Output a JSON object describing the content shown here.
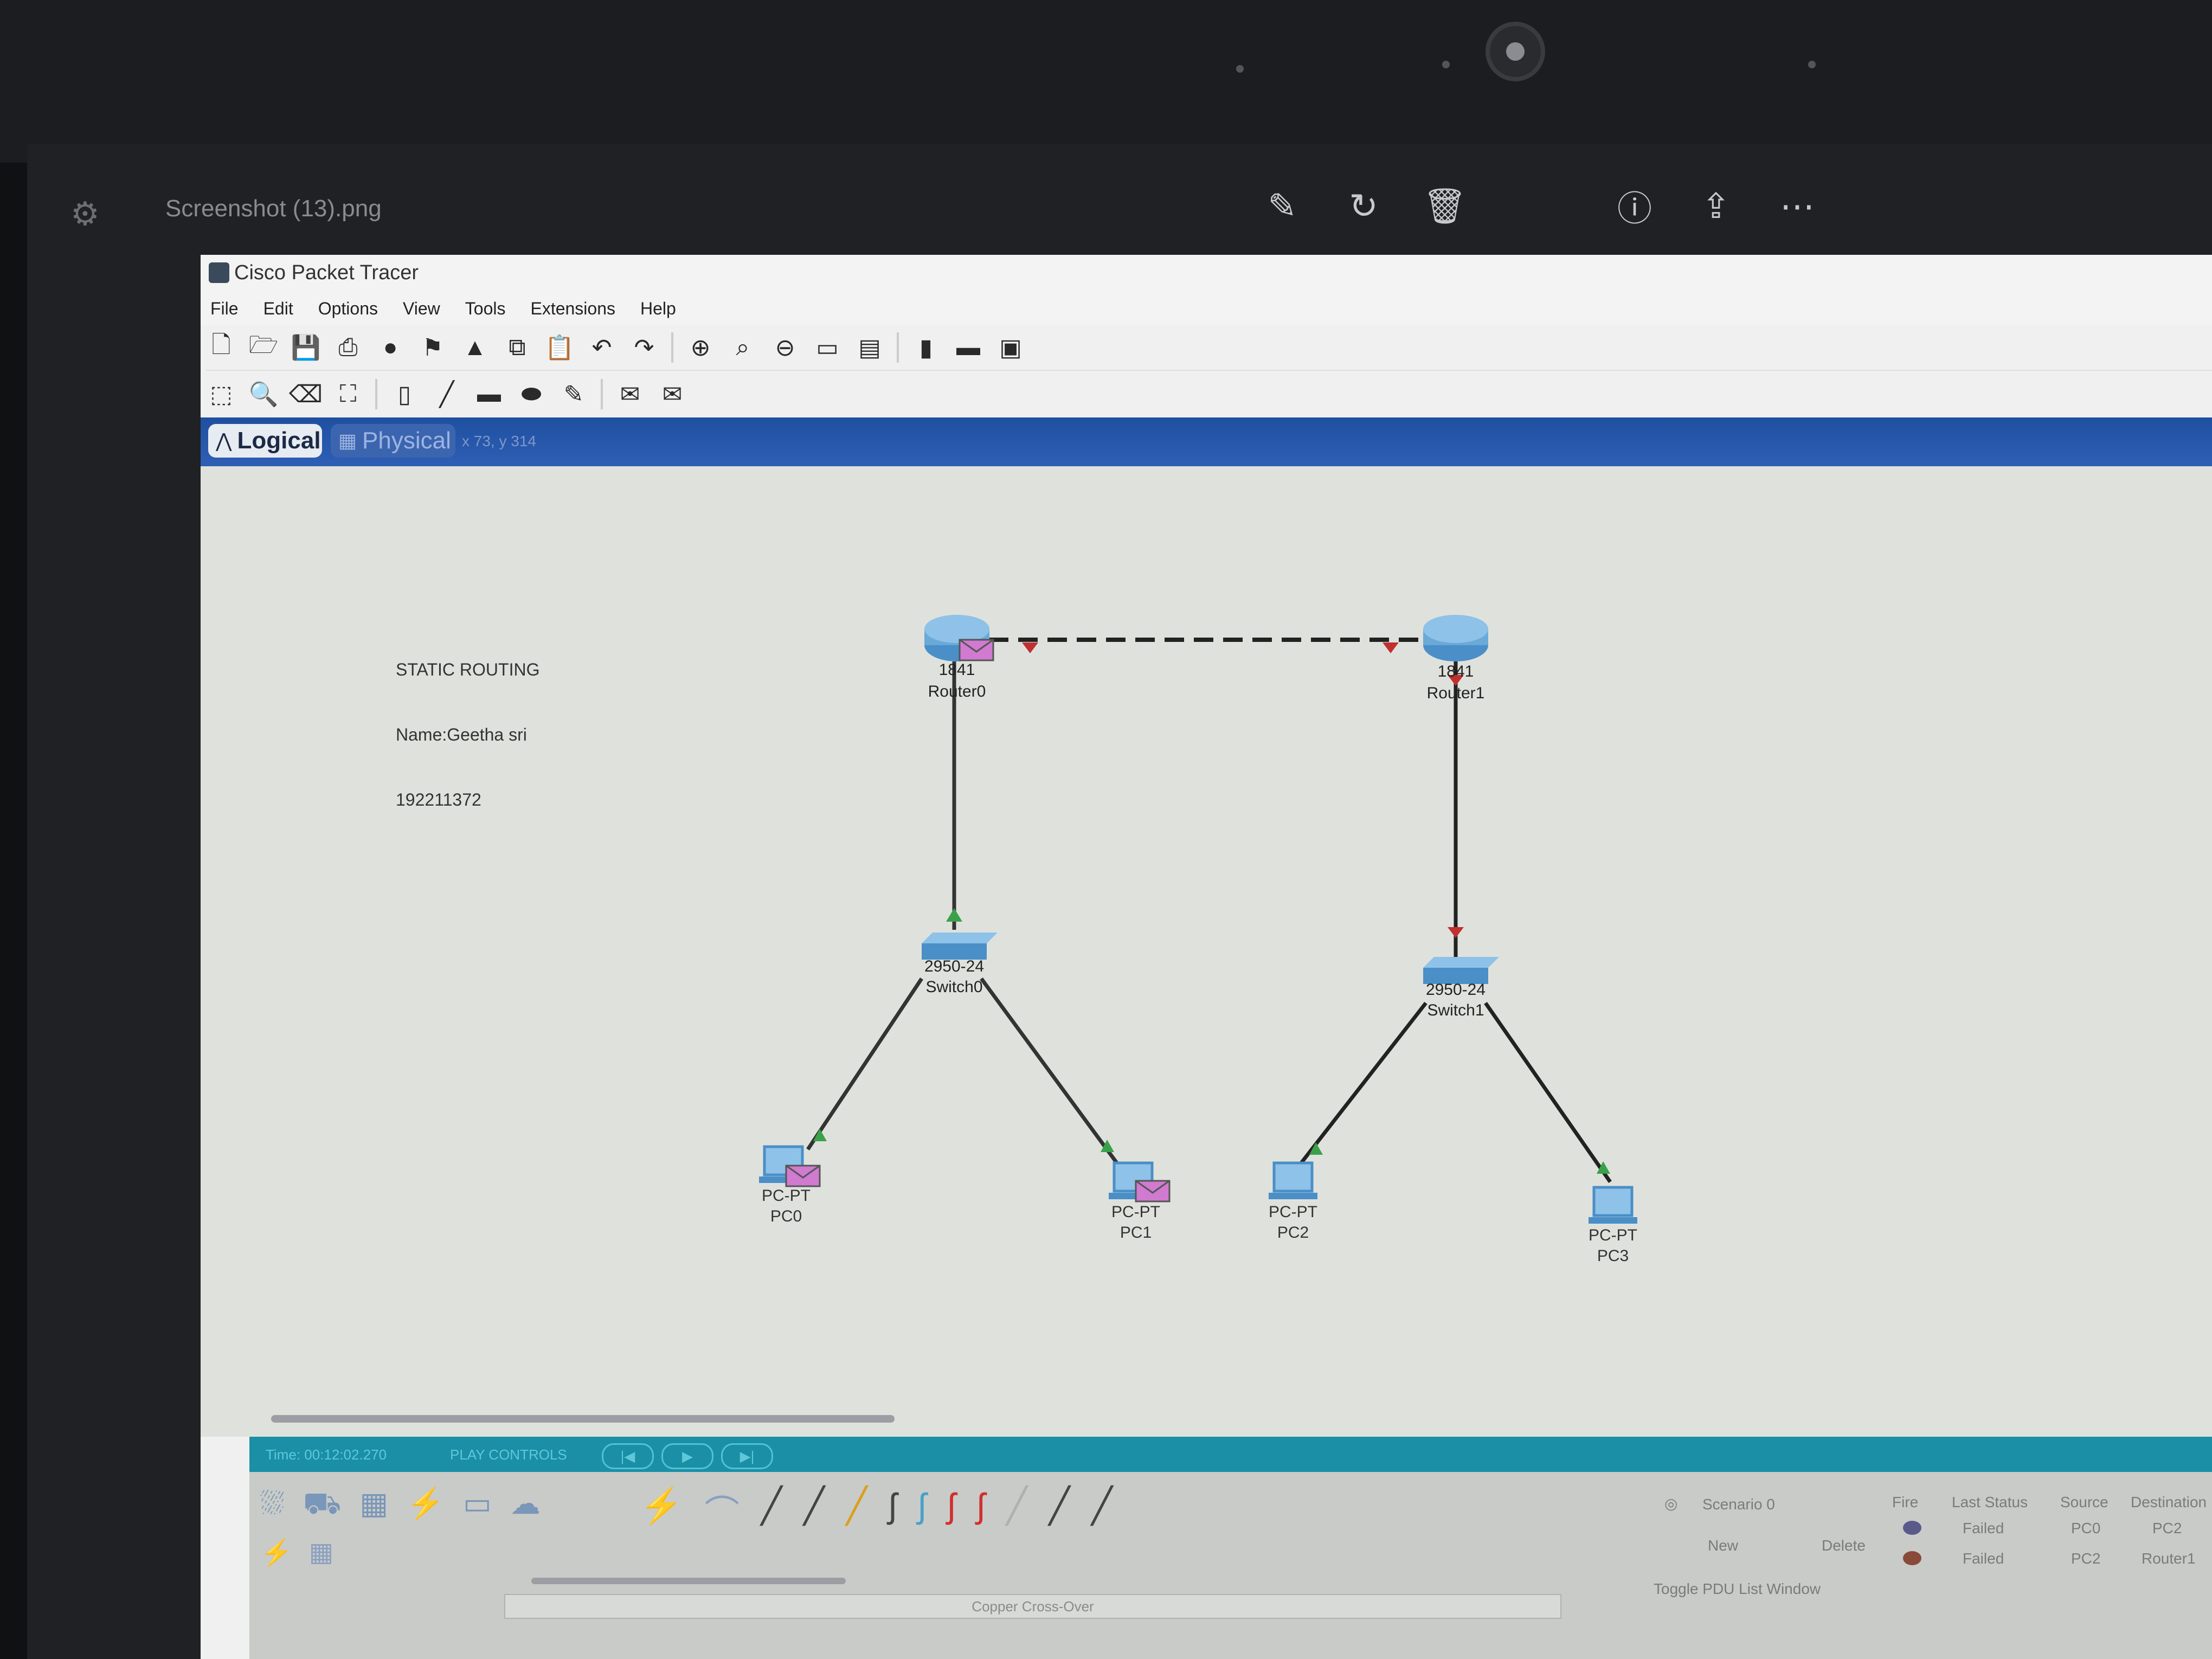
{
  "viewer": {
    "title": "Screenshot (13).png"
  },
  "app": {
    "title": "Cisco Packet Tracer",
    "menu": [
      "File",
      "Edit",
      "Options",
      "View",
      "Tools",
      "Extensions",
      "Help"
    ]
  },
  "tabs": {
    "logical": "Logical",
    "physical": "Physical",
    "coords": "x 73, y 314"
  },
  "note": {
    "lines": [
      "STATIC ROUTING",
      "Name:Geetha sri",
      "192211372"
    ]
  },
  "devices": {
    "router0": {
      "model": "1841",
      "name": "Router0"
    },
    "router1": {
      "model": "1841",
      "name": "Router1"
    },
    "switch0": {
      "model": "2950-24",
      "name": "Switch0"
    },
    "switch1": {
      "model": "2950-24",
      "name": "Switch1"
    },
    "pc0": {
      "model": "PC-PT",
      "name": "PC0"
    },
    "pc1": {
      "model": "PC-PT",
      "name": "PC1"
    },
    "pc2": {
      "model": "PC-PT",
      "name": "PC2"
    },
    "pc3": {
      "model": "PC-PT",
      "name": "PC3"
    }
  },
  "simulation": {
    "time": "Time: 00:12:02.270",
    "play_controls": "PLAY CONTROLS"
  },
  "bottom": {
    "search_placeholder": "Copper Cross-Over",
    "scenario": "Scenario 0",
    "new_btn": "New",
    "delete_btn": "Delete",
    "toggle_pdu": "Toggle PDU List Window",
    "pdu_headers": [
      "Fire",
      "Last Status",
      "Source",
      "Destination"
    ],
    "pdu_rows": [
      {
        "status": "Failed",
        "source": "PC0",
        "destination": "PC2",
        "color": "#5a5a8a"
      },
      {
        "status": "Failed",
        "source": "PC2",
        "destination": "Router1",
        "color": "#8a4a3a"
      }
    ]
  },
  "colors": {
    "tab_bar": "#1f4fa0",
    "sim_bar": "#1a8fa6",
    "workspace": "#dfe2dc",
    "link_up": "#3aa14a",
    "link_down": "#c03030",
    "device_blue": "#4a8fc8",
    "pdu_envelope": "#d07ad0"
  }
}
